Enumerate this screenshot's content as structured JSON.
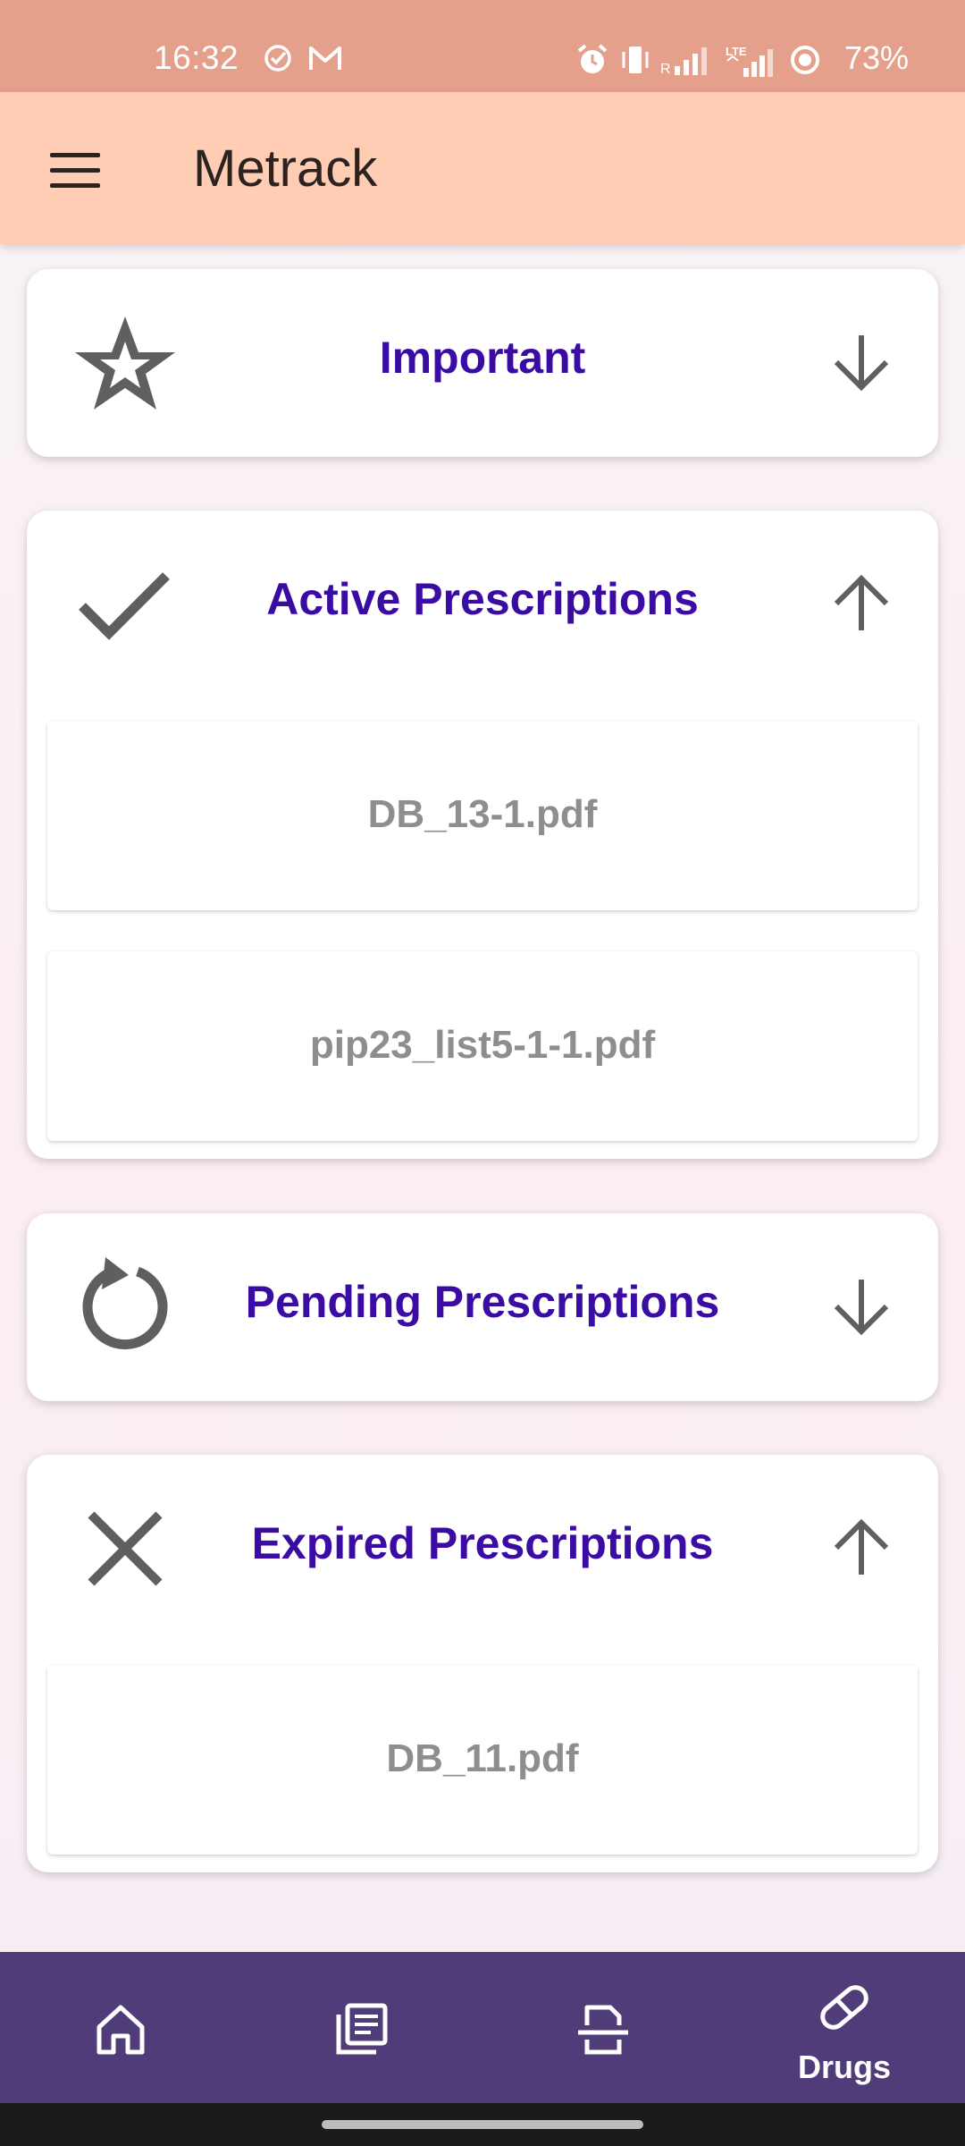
{
  "status_bar": {
    "time": "16:32",
    "battery": "73%",
    "icons": [
      "check-circle-icon",
      "gmail-icon",
      "alarm-icon",
      "vibrate-icon",
      "signal-r-icon",
      "lte-signal-icon",
      "battery-saver-icon"
    ]
  },
  "app_bar": {
    "title": "Metrack",
    "menu_icon": "hamburger-menu-icon"
  },
  "sections": [
    {
      "title": "Important",
      "icon": "star-icon",
      "expanded": false,
      "files": []
    },
    {
      "title": "Active Prescriptions",
      "icon": "check-icon",
      "expanded": true,
      "files": [
        "DB_13-1.pdf",
        "pip23_list5-1-1.pdf"
      ]
    },
    {
      "title": "Pending Prescriptions",
      "icon": "refresh-icon",
      "expanded": false,
      "files": []
    },
    {
      "title": "Expired Prescriptions",
      "icon": "close-icon",
      "expanded": true,
      "files": [
        "DB_11.pdf"
      ]
    }
  ],
  "bottom_nav": {
    "items": [
      {
        "icon": "home-icon",
        "label": ""
      },
      {
        "icon": "documents-icon",
        "label": ""
      },
      {
        "icon": "scan-document-icon",
        "label": ""
      },
      {
        "icon": "pill-icon",
        "label": "Drugs",
        "active": true
      }
    ]
  },
  "colors": {
    "status_bar": "#e5a08c",
    "app_bar": "#ffcdb3",
    "section_title": "#3a0ca3",
    "file_name": "#8e8e8e",
    "bottom_nav": "#4f3c78",
    "icon_gray": "#5f5f5f"
  }
}
